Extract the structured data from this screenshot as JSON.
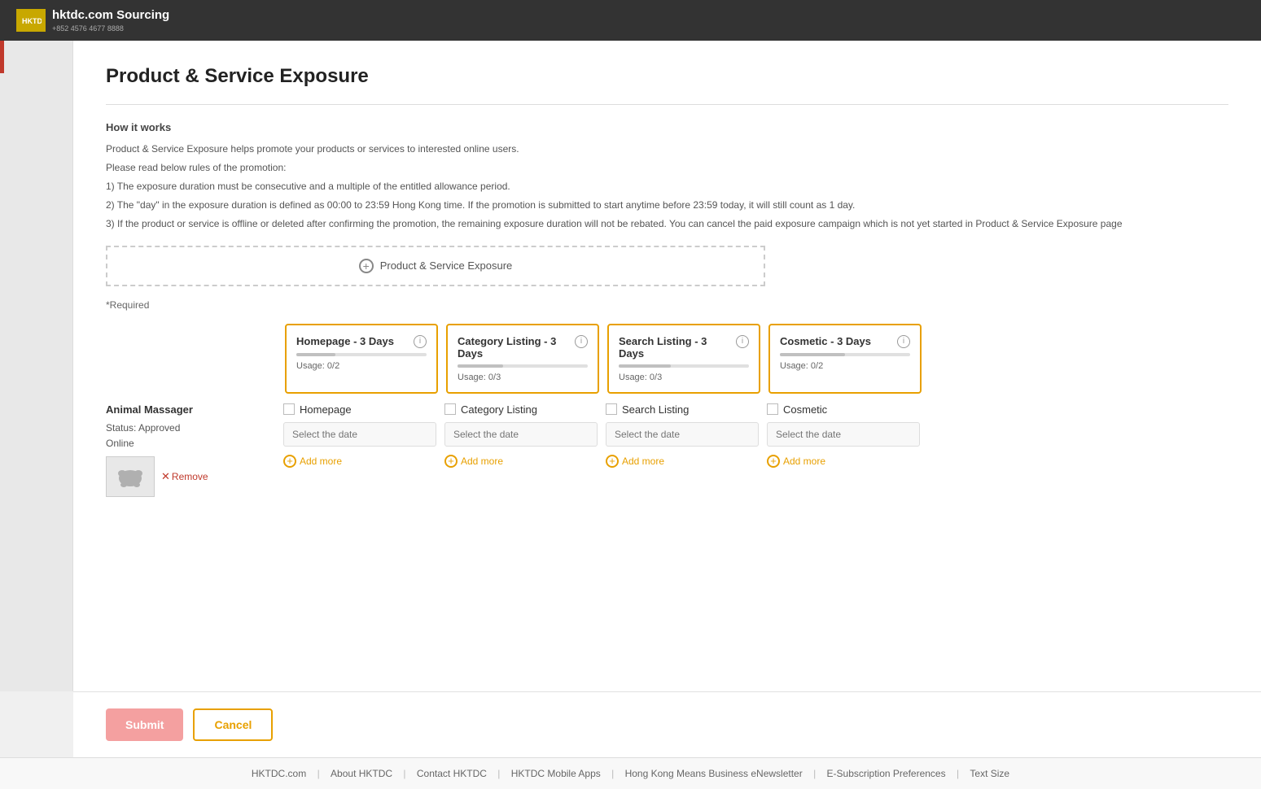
{
  "header": {
    "logo_text": "HKTDC",
    "sourcing_text": "hktdc.com Sourcing",
    "tagline": "+852 4576 4677 8888"
  },
  "page": {
    "title": "Product & Service Exposure",
    "required_label": "*Required",
    "how_it_works_title": "How it works",
    "info_lines": [
      "Product & Service Exposure helps promote your products or services to interested online users.",
      "Please read below rules of the promotion:",
      "1) The exposure duration must be consecutive and a multiple of the entitled allowance period.",
      "2) The \"day\" in the exposure duration is defined as 00:00 to 23:59 Hong Kong time. If the promotion is submitted to start anytime before 23:59 today, it will still count as 1 day.",
      "3) If the product or service is offline or deleted after confirming the promotion, the remaining exposure duration will not be rebated. You can cancel the paid exposure campaign which is not yet started in Product & Service Exposure page"
    ],
    "add_exposure_label": "Product & Service Exposure"
  },
  "cards": [
    {
      "id": "homepage",
      "title": "Homepage - 3 Days",
      "usage": "Usage: 0/2",
      "progress_pct": 30,
      "progress_color": "#c0c0c0",
      "slot_label": "Homepage",
      "date_placeholder": "Select the date"
    },
    {
      "id": "category",
      "title": "Category Listing - 3 Days",
      "usage": "Usage: 0/3",
      "progress_pct": 35,
      "progress_color": "#c0c0c0",
      "slot_label": "Category Listing",
      "date_placeholder": "Select the date"
    },
    {
      "id": "search",
      "title": "Search Listing - 3 Days",
      "usage": "Usage: 0/3",
      "progress_pct": 40,
      "progress_color": "#c0c0c0",
      "slot_label": "Search Listing",
      "date_placeholder": "Select the date"
    },
    {
      "id": "cosmetic",
      "title": "Cosmetic - 3 Days",
      "usage": "Usage: 0/2",
      "progress_pct": 50,
      "progress_color": "#c0c0c0",
      "slot_label": "Cosmetic",
      "date_placeholder": "Select the date"
    }
  ],
  "product": {
    "name": "Animal Massager",
    "status_label": "Status:",
    "status_value": "Approved",
    "online_label": "Online",
    "remove_label": "Remove"
  },
  "add_more_label": "Add more",
  "buttons": {
    "submit": "Submit",
    "cancel": "Cancel"
  },
  "footer": {
    "links": [
      "HKTDC.com",
      "About HKTDC",
      "Contact HKTDC",
      "HKTDC Mobile Apps",
      "Hong Kong Means Business eNewsletter",
      "E-Subscription Preferences",
      "Text Size"
    ]
  }
}
